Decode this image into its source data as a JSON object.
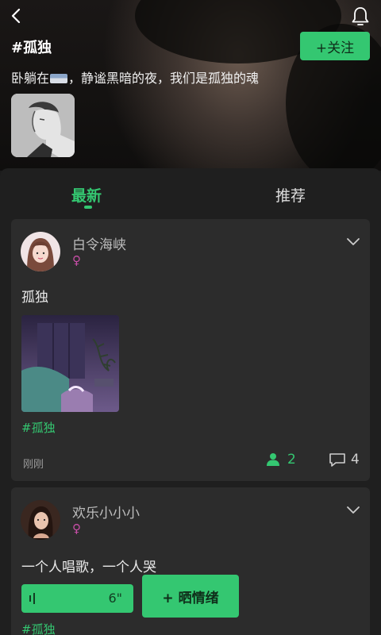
{
  "header": {
    "topic_title": "#孤独",
    "follow_label": "+关注",
    "description_before": "卧躺在",
    "description_after": "，静谧黑暗的夜，我们是孤独的魂"
  },
  "tabs": {
    "latest": "最新",
    "recommend": "推荐",
    "active": "latest"
  },
  "posts": [
    {
      "username": "白令海峡",
      "gender_symbol": "♀",
      "text": "孤独",
      "hashtag": "#孤独",
      "time": "刚刚",
      "likes": "2",
      "comments": "4"
    },
    {
      "username": "欢乐小小小",
      "gender_symbol": "♀",
      "text": "一个人唱歌，一个人哭",
      "voice_duration": "6\"",
      "share_label": "+ 晒情绪",
      "hashtag": "#孤独"
    }
  ],
  "colors": {
    "accent": "#34c771",
    "card_bg": "#2c2c2c",
    "page_bg": "#1b1b1b",
    "gender_female": "#c94ea8"
  },
  "icons": [
    "back-arrow-icon",
    "bell-icon",
    "bed-emoji",
    "chevron-down-icon",
    "user-like-icon",
    "comment-bubble-icon",
    "voice-wave-icon"
  ]
}
